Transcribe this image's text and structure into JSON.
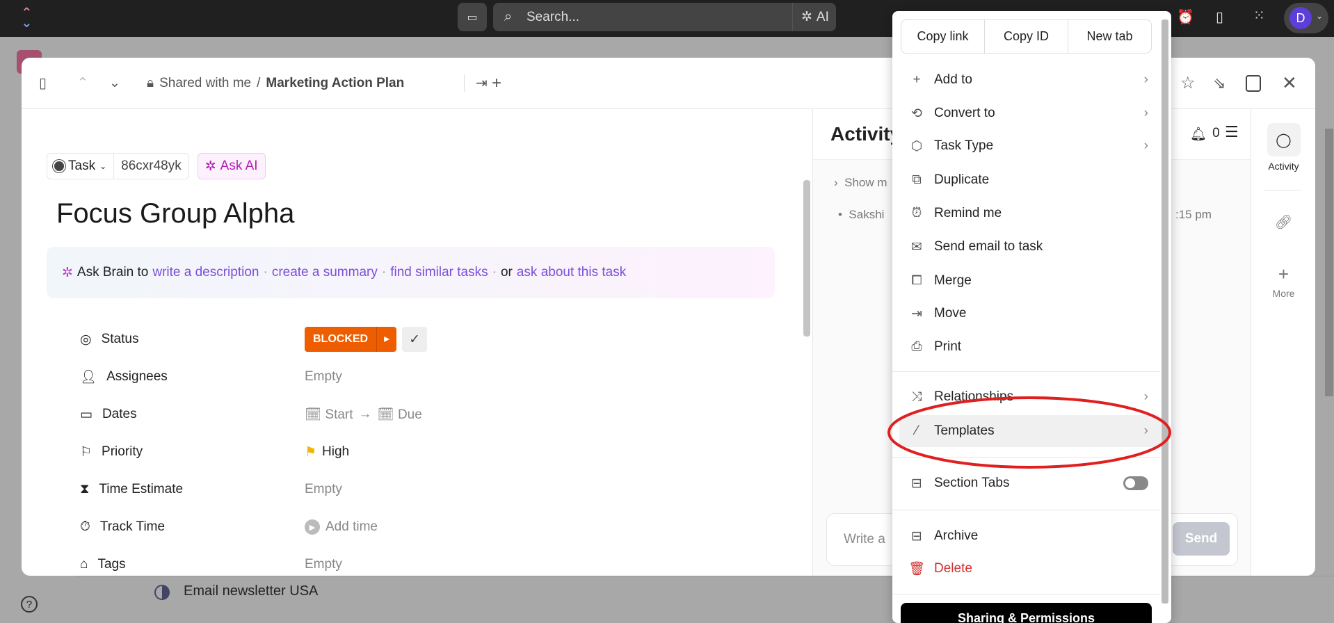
{
  "topbar": {
    "search_placeholder": "Search...",
    "ai_label": "AI",
    "avatar_initial": "D"
  },
  "background": {
    "list_item": "Email newsletter USA"
  },
  "header": {
    "breadcrumb_shared": "Shared with me",
    "breadcrumb_sep": "/",
    "breadcrumb_list": "Marketing Action Plan"
  },
  "task": {
    "type_label": "Task",
    "task_id": "86cxr48yk",
    "ask_ai": "Ask AI",
    "title": "Focus Group Alpha"
  },
  "ask_brain": {
    "prefix": "Ask Brain to",
    "link1": "write a description",
    "sep": "·",
    "link2": "create a summary",
    "link3": "find similar tasks",
    "or": "or",
    "link4": "ask about this task"
  },
  "fields": [
    {
      "label": "Status",
      "value": "BLOCKED"
    },
    {
      "label": "Assignees",
      "value": "Empty"
    },
    {
      "label": "Dates",
      "start": "Start",
      "due": "Due"
    },
    {
      "label": "Priority",
      "value": "High"
    },
    {
      "label": "Time Estimate",
      "value": "Empty"
    },
    {
      "label": "Track Time",
      "value": "Add time"
    },
    {
      "label": "Tags",
      "value": "Empty"
    }
  ],
  "activity": {
    "title": "Activity",
    "bell_count": "0",
    "show_more": "Show m",
    "entry": "Sakshi",
    "time": ":15 pm",
    "comment_placeholder": "Write a",
    "send": "Send"
  },
  "rside": {
    "activity": "Activity",
    "more": "More"
  },
  "menu": {
    "top_buttons": [
      "Copy link",
      "Copy ID",
      "New tab"
    ],
    "items": [
      "Add to",
      "Convert to",
      "Task Type",
      "Duplicate",
      "Remind me",
      "Send email to task",
      "Merge",
      "Move",
      "Print"
    ],
    "items2": [
      "Relationships",
      "Templates"
    ],
    "section_tabs": "Section Tabs",
    "section_tabs_on": false,
    "archive": "Archive",
    "delete": "Delete",
    "sharing": "Sharing & Permissions"
  },
  "colors": {
    "blocked": "#ee5e00",
    "delete": "#d32f2f",
    "accent": "#7b4ed8",
    "highlight": "#e02020"
  }
}
